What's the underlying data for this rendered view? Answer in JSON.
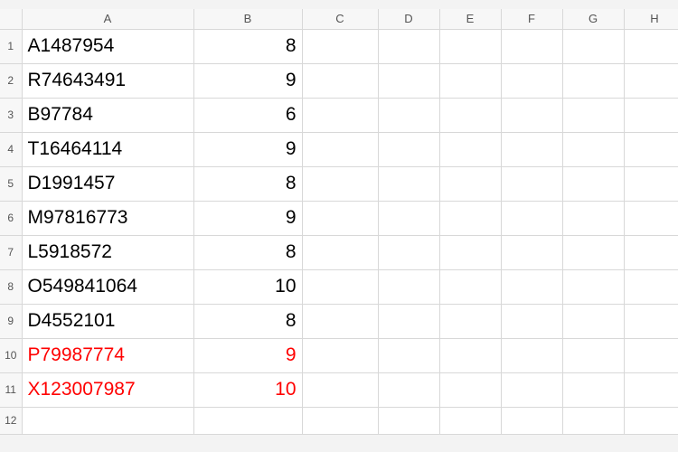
{
  "columns": [
    "A",
    "B",
    "C",
    "D",
    "E",
    "F",
    "G",
    "H"
  ],
  "row_numbers": [
    "1",
    "2",
    "3",
    "4",
    "5",
    "6",
    "7",
    "8",
    "9",
    "10",
    "11",
    "12"
  ],
  "rows": [
    {
      "a": "A1487954",
      "b": "8",
      "red": false
    },
    {
      "a": "R74643491",
      "b": "9",
      "red": false
    },
    {
      "a": "B97784",
      "b": "6",
      "red": false
    },
    {
      "a": "T16464114",
      "b": "9",
      "red": false
    },
    {
      "a": "D1991457",
      "b": "8",
      "red": false
    },
    {
      "a": "M97816773",
      "b": "9",
      "red": false
    },
    {
      "a": "L5918572",
      "b": "8",
      "red": false
    },
    {
      "a": "O549841064",
      "b": "10",
      "red": false
    },
    {
      "a": "D4552101",
      "b": "8",
      "red": false
    },
    {
      "a": "P79987774",
      "b": "9",
      "red": true
    },
    {
      "a": "X123007987",
      "b": "10",
      "red": true
    },
    {
      "a": "",
      "b": "",
      "red": false
    }
  ],
  "chart_data": {
    "type": "table",
    "columns": [
      "A",
      "B"
    ],
    "data": [
      [
        "A1487954",
        8
      ],
      [
        "R74643491",
        9
      ],
      [
        "B97784",
        6
      ],
      [
        "T16464114",
        9
      ],
      [
        "D1991457",
        8
      ],
      [
        "M97816773",
        9
      ],
      [
        "L5918572",
        8
      ],
      [
        "O549841064",
        10
      ],
      [
        "D4552101",
        8
      ],
      [
        "P79987774",
        9
      ],
      [
        "X123007987",
        10
      ]
    ]
  }
}
